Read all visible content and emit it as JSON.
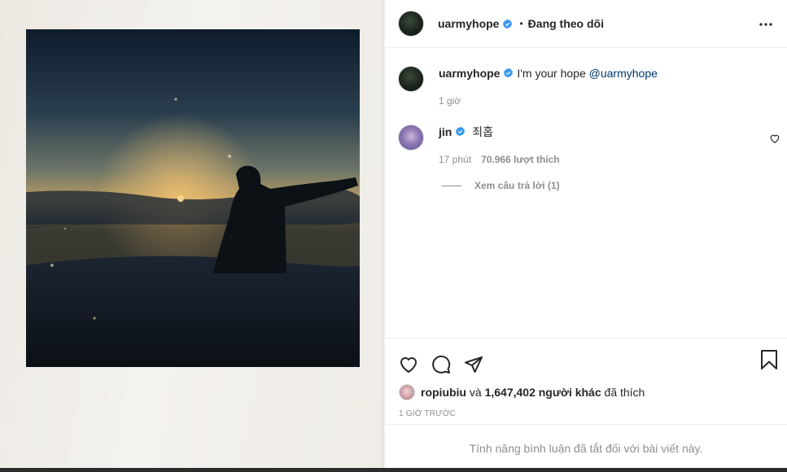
{
  "post_header": {
    "username": "uarmyhope",
    "separator": "•",
    "follow_status": "Đang theo dõi",
    "more_icon": "more-horizontal-icon"
  },
  "caption": {
    "username": "uarmyhope",
    "text": "I'm your hope",
    "mention": "@uarmyhope",
    "time": "1 giờ"
  },
  "reply": {
    "username": "jin",
    "text": "죄홉",
    "time": "17 phút",
    "likes": "70.966 lượt thích",
    "view_replies": "Xem câu trả lời (1)"
  },
  "actions": {
    "like_icon": "heart-icon",
    "comment_icon": "comment-icon",
    "share_icon": "share-icon",
    "save_icon": "bookmark-icon"
  },
  "likes_summary": {
    "user": "ropiubiu",
    "and": "và",
    "count": "1,647,402 người khác",
    "suffix": "đã thích"
  },
  "post_time": "1 GIỜ TRƯỚC",
  "comments_disabled": "Tính năng bình luận đã tắt đối với bài viết này.",
  "colors": {
    "verified": "#3897f0",
    "mention": "#00376b",
    "muted": "#8e8e8e",
    "text": "#262626"
  }
}
